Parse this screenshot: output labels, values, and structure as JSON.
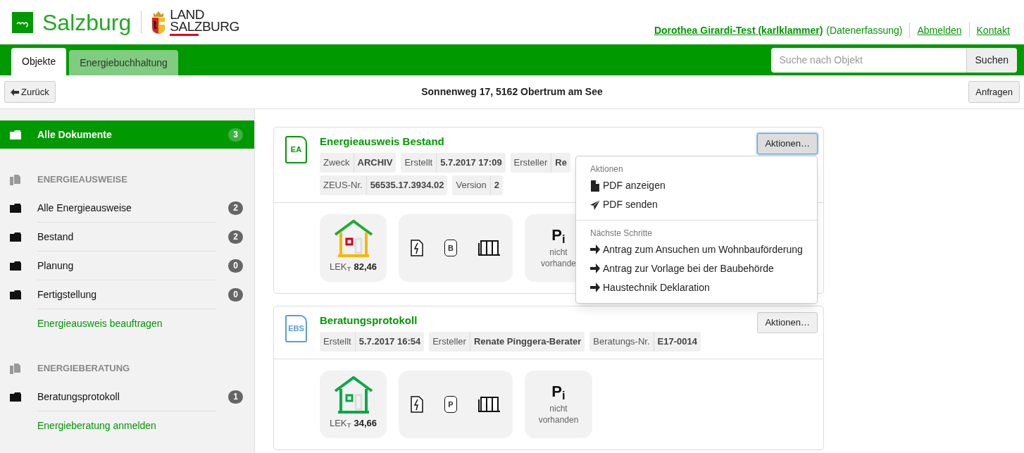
{
  "header": {
    "brand": "Salzburg",
    "partner_lines": [
      "LAND",
      "SALZBURG"
    ],
    "user": "Dorothea Girardi-Test (karlklammer)",
    "role": "(Datenerfassung)",
    "links": [
      "Abmelden",
      "Kontakt"
    ]
  },
  "tabs": [
    {
      "label": "Objekte",
      "selected": true
    },
    {
      "label": "Energiebuchhaltung",
      "selected": false
    }
  ],
  "search": {
    "placeholder": "Suche nach Objekt",
    "button": "Suchen"
  },
  "toolbar": {
    "back": "Zurück",
    "address": "Sonnenweg 17, 5162 Obertrum am See",
    "request": "Anfragen"
  },
  "sidebar": {
    "top": {
      "label": "Alle Dokumente",
      "count": "3",
      "selected": true
    },
    "sections": [
      {
        "title": "ENERGIEAUSWEISE",
        "items": [
          {
            "label": "Alle Energieausweise",
            "count": "2",
            "selected": false
          },
          {
            "label": "Bestand",
            "count": "2",
            "selected": false
          },
          {
            "label": "Planung",
            "count": "0",
            "selected": false
          },
          {
            "label": "Fertigstellung",
            "count": "0",
            "selected": false
          }
        ],
        "link": "Energieausweis beauftragen"
      },
      {
        "title": "ENERGIEBERATUNG",
        "items": [
          {
            "label": "Beratungsprotokoll",
            "count": "1",
            "selected": false
          }
        ],
        "link": "Energieberatung anmelden"
      }
    ]
  },
  "documents": [
    {
      "badge": "EA",
      "color": "#009900",
      "title": "Energieausweis Bestand",
      "tag_rows": [
        [
          {
            "key": "Zweck",
            "value": "ARCHIV"
          },
          {
            "key": "Erstellt",
            "value": "5.7.2017 17:09"
          },
          {
            "key": "Ersteller",
            "value": "Re"
          }
        ],
        [
          {
            "key": "ZEUS-Nr.",
            "value": "56535.17.3934.02"
          },
          {
            "key": "Version",
            "value": "2"
          }
        ]
      ],
      "actions": {
        "label": "Aktionen…",
        "expanded": true
      },
      "house": {
        "kind": "mixed"
      },
      "lek_label": "LEK$_{T}$",
      "lek_value": "82,46",
      "tank_letter": "B",
      "pi_label": "P$_{i}$",
      "pi_status": "nicht vorhande"
    },
    {
      "badge": "EBS",
      "color": "#5b9bd5",
      "title": "Beratungsprotokoll",
      "tag_rows": [
        [
          {
            "key": "Erstellt",
            "value": "5.7.2017 16:54"
          },
          {
            "key": "Ersteller",
            "value": "Renate Pinggera-Berater"
          },
          {
            "key": "Beratungs-Nr.",
            "value": "E17-0014"
          }
        ]
      ],
      "actions": {
        "label": "Aktionen…",
        "expanded": false
      },
      "house": {
        "kind": "green"
      },
      "lek_label": "LEK$_{T}$",
      "lek_value": "34,66",
      "tank_letter": "P",
      "pi_label": "P$_{i}$",
      "pi_status": "nicht vorhanden"
    }
  ],
  "menu": {
    "sections": [
      {
        "heading": "Aktionen",
        "items": [
          {
            "label": "PDF anzeigen",
            "kind": "file"
          },
          {
            "label": "PDF senden",
            "kind": "send"
          }
        ]
      },
      {
        "heading": "Nächste Schritte",
        "items": [
          {
            "label": "Antrag zum Ansuchen um Wohnbauförderung",
            "kind": "arrow"
          },
          {
            "label": "Antrag zur Vorlage bei der Baubehörde",
            "kind": "arrow"
          },
          {
            "label": "Haustechnik Deklaration",
            "kind": "arrow"
          }
        ]
      }
    ]
  }
}
